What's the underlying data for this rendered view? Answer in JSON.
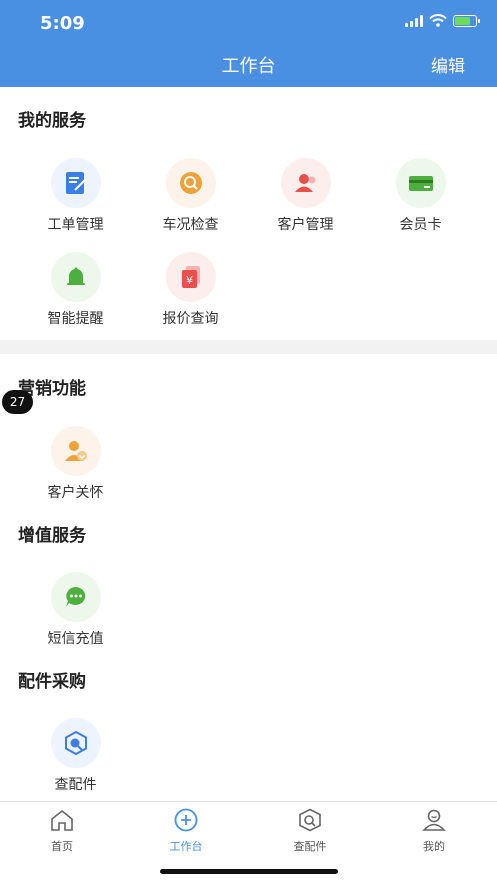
{
  "status_bar": {
    "time": "5:09"
  },
  "header": {
    "title": "工作台",
    "edit": "编辑"
  },
  "sections": {
    "my_services": {
      "title": "我的服务",
      "items": [
        {
          "label": "工单管理",
          "icon": "work-order-icon"
        },
        {
          "label": "车况检查",
          "icon": "car-inspection-icon"
        },
        {
          "label": "客户管理",
          "icon": "customer-management-icon"
        },
        {
          "label": "会员卡",
          "icon": "member-card-icon"
        },
        {
          "label": "智能提醒",
          "icon": "bell-icon"
        },
        {
          "label": "报价查询",
          "icon": "price-query-icon"
        }
      ]
    },
    "marketing": {
      "title": "营销功能",
      "items": [
        {
          "label": "客户关怀",
          "icon": "customer-care-icon"
        }
      ]
    },
    "value_added": {
      "title": "增值服务",
      "items": [
        {
          "label": "短信充值",
          "icon": "sms-icon"
        }
      ]
    },
    "parts": {
      "title": "配件采购",
      "items": [
        {
          "label": "查配件",
          "icon": "parts-search-icon"
        }
      ]
    }
  },
  "badge": {
    "value": "27"
  },
  "tabbar": {
    "items": [
      {
        "label": "首页",
        "icon": "home-icon"
      },
      {
        "label": "工作台",
        "icon": "workbench-icon",
        "active": true
      },
      {
        "label": "查配件",
        "icon": "parts-icon"
      },
      {
        "label": "我的",
        "icon": "profile-icon"
      }
    ]
  },
  "colors": {
    "primary": "#4a90e2",
    "divider": "#f2f2f2"
  }
}
